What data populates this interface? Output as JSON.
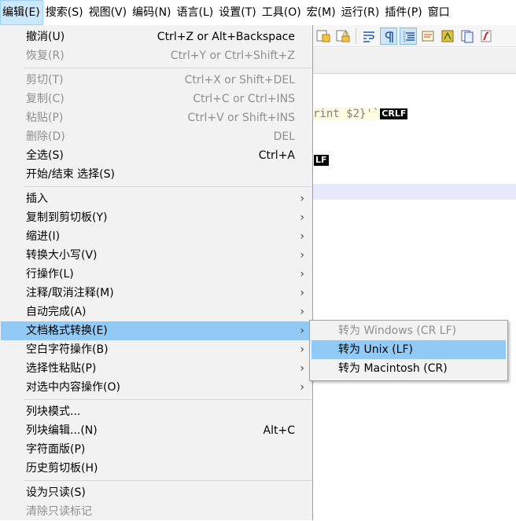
{
  "menubar": {
    "items": [
      {
        "label": "编辑(E)",
        "name": "menubar-edit"
      },
      {
        "label": "搜索(S)",
        "name": "menubar-search"
      },
      {
        "label": "视图(V)",
        "name": "menubar-view"
      },
      {
        "label": "编码(N)",
        "name": "menubar-encoding"
      },
      {
        "label": "语言(L)",
        "name": "menubar-language"
      },
      {
        "label": "设置(T)",
        "name": "menubar-settings"
      },
      {
        "label": "工具(O)",
        "name": "menubar-tools"
      },
      {
        "label": "宏(M)",
        "name": "menubar-macro"
      },
      {
        "label": "运行(R)",
        "name": "menubar-run"
      },
      {
        "label": "插件(P)",
        "name": "menubar-plugins"
      },
      {
        "label": "窗口",
        "name": "menubar-window"
      }
    ]
  },
  "toolbar": {
    "icons": [
      "find-replace-icon",
      "lock-icon",
      "wrap-icon",
      "show-all-chars-icon",
      "indent-guide-icon",
      "doc-map-icon",
      "function-list-icon",
      "folder-workspace-icon",
      "monitoring-icon",
      "macro-record-icon"
    ]
  },
  "editor": {
    "line1_text": "rint $2}'`",
    "line1_eol": "CRLF",
    "line2_eol": "LF"
  },
  "edit_menu": {
    "items": [
      {
        "label": "撤消(U)",
        "shortcut": "Ctrl+Z or Alt+Backspace",
        "disabled": false
      },
      {
        "label": "恢复(R)",
        "shortcut": "Ctrl+Y or Ctrl+Shift+Z",
        "disabled": true
      },
      {
        "label": "剪切(T)",
        "shortcut": "Ctrl+X or Shift+DEL",
        "disabled": true
      },
      {
        "label": "复制(C)",
        "shortcut": "Ctrl+C or Ctrl+INS",
        "disabled": true
      },
      {
        "label": "粘贴(P)",
        "shortcut": "Ctrl+V or Shift+INS",
        "disabled": true
      },
      {
        "label": "删除(D)",
        "shortcut": "DEL",
        "disabled": true
      },
      {
        "label": "全选(S)",
        "shortcut": "Ctrl+A",
        "disabled": false
      },
      {
        "label": "开始/结束 选择(S)",
        "shortcut": "",
        "disabled": false
      },
      {
        "label": "插入",
        "submenu": true
      },
      {
        "label": "复制到剪切板(Y)",
        "submenu": true
      },
      {
        "label": "缩进(I)",
        "submenu": true
      },
      {
        "label": "转换大小写(V)",
        "submenu": true
      },
      {
        "label": "行操作(L)",
        "submenu": true
      },
      {
        "label": "注释/取消注释(M)",
        "submenu": true
      },
      {
        "label": "自动完成(A)",
        "submenu": true
      },
      {
        "label": "文档格式转换(E)",
        "submenu": true,
        "highlighted": true
      },
      {
        "label": "空白字符操作(B)",
        "submenu": true
      },
      {
        "label": "选择性粘贴(P)",
        "submenu": true
      },
      {
        "label": "对选中内容操作(O)",
        "submenu": true
      },
      {
        "label": "列块模式...",
        "shortcut": ""
      },
      {
        "label": "列块编辑...(N)",
        "shortcut": "Alt+C"
      },
      {
        "label": "字符面版(P)",
        "shortcut": ""
      },
      {
        "label": "历史剪切板(H)",
        "shortcut": ""
      },
      {
        "label": "设为只读(S)",
        "shortcut": ""
      },
      {
        "label": "清除只读标记",
        "shortcut": "",
        "disabled": true
      }
    ],
    "submenu_arrow": "›"
  },
  "eol_submenu": {
    "items": [
      {
        "label": "转为 Windows (CR LF)",
        "disabled": true
      },
      {
        "label": "转为 Unix (LF)",
        "highlighted": true
      },
      {
        "label": "转为 Macintosh (CR)"
      }
    ]
  },
  "colors": {
    "highlight": "#91c9f7",
    "menu_bg": "#f2f2f2",
    "menubar_active": "#cce8ff"
  }
}
